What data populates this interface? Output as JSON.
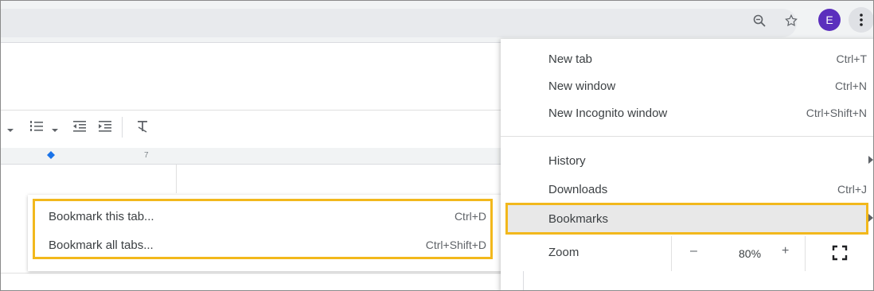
{
  "menu": {
    "items": [
      {
        "label": "New tab",
        "shortcut": "Ctrl+T"
      },
      {
        "label": "New window",
        "shortcut": "Ctrl+N"
      },
      {
        "label": "New Incognito window",
        "shortcut": "Ctrl+Shift+N"
      },
      {
        "label": "History",
        "shortcut": ""
      },
      {
        "label": "Downloads",
        "shortcut": "Ctrl+J"
      },
      {
        "label": "Bookmarks",
        "shortcut": ""
      }
    ],
    "zoom": {
      "label": "Zoom",
      "minus": "–",
      "value": "80%",
      "plus": "+"
    }
  },
  "bookmarks_submenu": {
    "items": [
      {
        "label": "Bookmark this tab...",
        "shortcut": "Ctrl+D"
      },
      {
        "label": "Bookmark all tabs...",
        "shortcut": "Ctrl+Shift+D"
      }
    ]
  },
  "toolbar": {
    "avatar_letter": "E",
    "ruler_mark": "7"
  },
  "icons": {
    "zoom": "zoom-icon",
    "star": "bookmark-star-icon",
    "menu": "more-vert-icon",
    "list": "numbered-list-icon",
    "indent_decrease": "indent-decrease-icon",
    "indent_increase": "indent-increase-icon",
    "clear_format": "clear-formatting-icon",
    "fullscreen": "fullscreen-icon"
  },
  "colors": {
    "highlight": "#f2b81c",
    "avatar": "#5b2fbd"
  }
}
